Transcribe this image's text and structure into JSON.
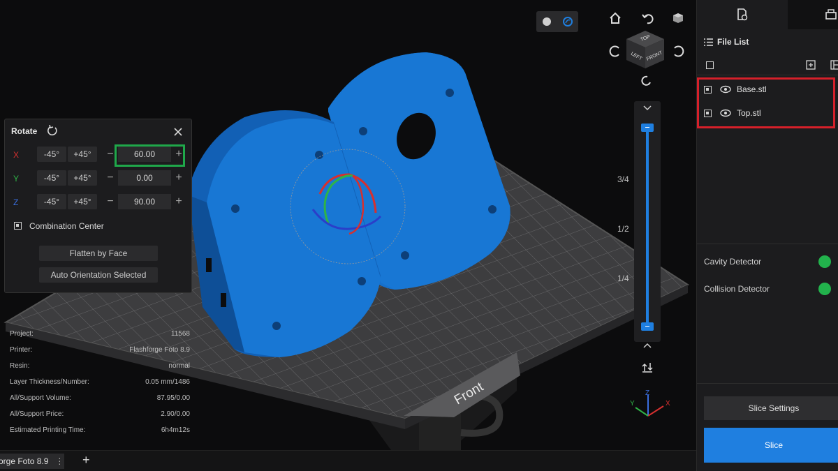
{
  "view_modes": [
    "solid-sphere-icon",
    "wireframe-sphere-icon"
  ],
  "navigation": {
    "cube_faces": {
      "top": "TOP",
      "left": "LEFT",
      "front": "FRONT"
    }
  },
  "layer_slider": {
    "marks": [
      "3/4",
      "1/2",
      "1/4"
    ],
    "fill_fraction": 1.0
  },
  "viewport": {
    "bed_label": "Front",
    "axis_labels": {
      "x": "X",
      "y": "Y",
      "z": "Z"
    }
  },
  "rotate_panel": {
    "title": "Rotate",
    "rows": [
      {
        "axis": "X",
        "minus45": "-45°",
        "plus45": "+45°",
        "value": "60.00",
        "color": "#d6302f"
      },
      {
        "axis": "Y",
        "minus45": "-45°",
        "plus45": "+45°",
        "value": "0.00",
        "color": "#2fb347"
      },
      {
        "axis": "Z",
        "minus45": "-45°",
        "plus45": "+45°",
        "value": "90.00",
        "color": "#3b6fe0"
      }
    ],
    "combination_center": "Combination Center",
    "flatten_by_face": "Flatten by Face",
    "auto_orientation": "Auto Orientation Selected"
  },
  "project_info": [
    {
      "key": "Project:",
      "value": "11568"
    },
    {
      "key": "Printer:",
      "value": "Flashforge Foto 8.9"
    },
    {
      "key": "Resin:",
      "value": "normal"
    },
    {
      "key": "Layer Thickness/Number:",
      "value": "0.05 mm/1486"
    },
    {
      "key": "All/Support Volume:",
      "value": "87.95/0.00"
    },
    {
      "key": "All/Support Price:",
      "value": "2.90/0.00"
    },
    {
      "key": "Estimated Printing Time:",
      "value": "6h4m12s"
    }
  ],
  "bottom_bar": {
    "printer_tab": "orge Foto 8.9",
    "more": "⋮",
    "add": "+"
  },
  "right_panel": {
    "file_list_title": "File List",
    "files": [
      "Base.stl",
      "Top.stl"
    ],
    "detectors": [
      {
        "label": "Cavity Detector"
      },
      {
        "label": "Collision Detector"
      }
    ],
    "slice_settings": "Slice Settings",
    "slice": "Slice"
  },
  "colors": {
    "accent": "#1f7fe0",
    "model": "#1877d4",
    "highlight_green": "#1fa84a",
    "highlight_red": "#d6202a"
  }
}
